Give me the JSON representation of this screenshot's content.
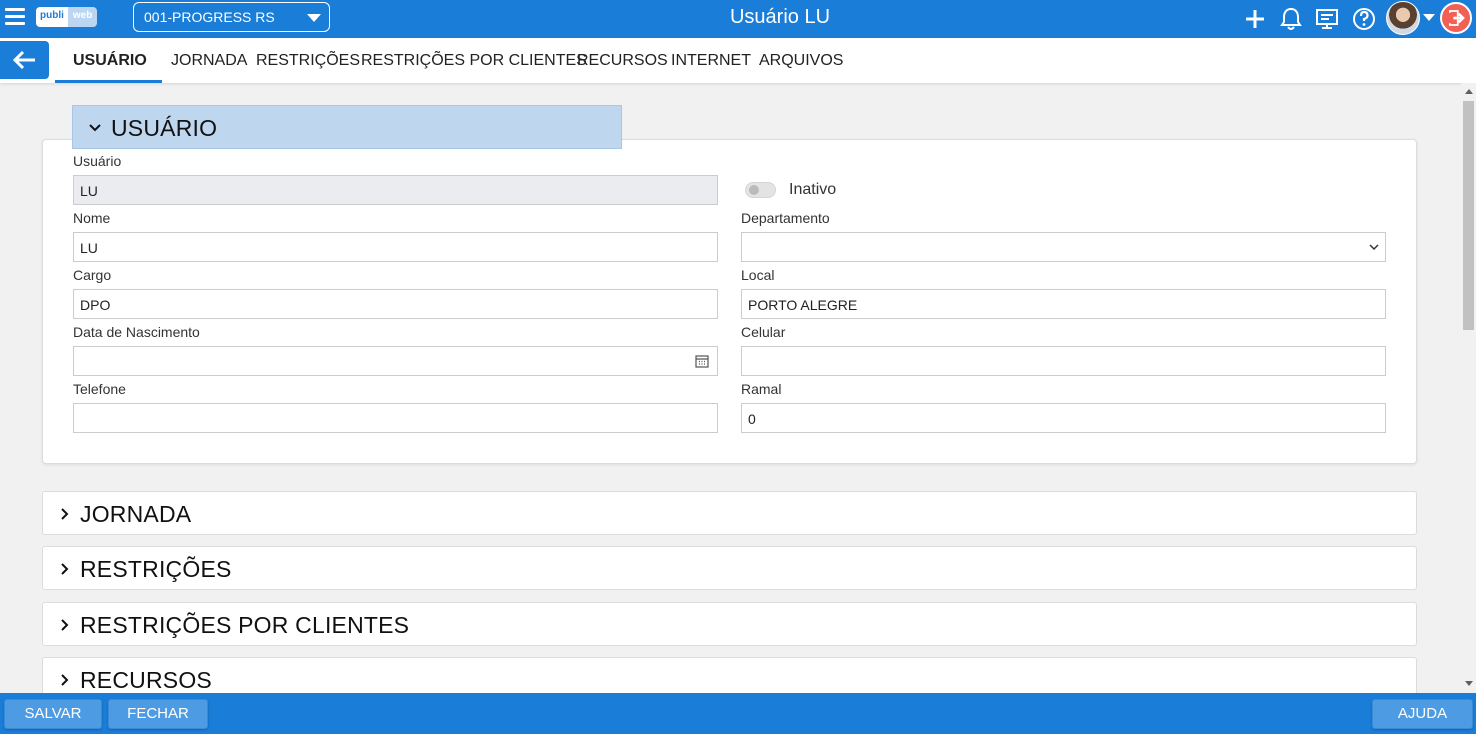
{
  "header": {
    "logo_part1": "publi",
    "logo_part2": "web",
    "company": "001-PROGRESS RS",
    "title": "Usuário LU",
    "icons": [
      "menu-icon",
      "plus-icon",
      "bell-icon",
      "monitor-icon",
      "help-icon",
      "avatar",
      "chevron-down-icon",
      "logout-icon"
    ]
  },
  "tabs": [
    {
      "label": "USUÁRIO",
      "active": true
    },
    {
      "label": "JORNADA"
    },
    {
      "label": "RESTRIÇÕES"
    },
    {
      "label": "RESTRIÇÕES POR CLIENTES"
    },
    {
      "label": "RECURSOS"
    },
    {
      "label": "INTERNET"
    },
    {
      "label": "ARQUIVOS"
    }
  ],
  "usuario_section": {
    "title": "USUÁRIO",
    "fields": {
      "usuario": {
        "label": "Usuário",
        "value": "LU"
      },
      "inativo": {
        "label": "Inativo",
        "checked": false
      },
      "nome": {
        "label": "Nome",
        "value": "LU"
      },
      "departamento": {
        "label": "Departamento",
        "value": ""
      },
      "cargo": {
        "label": "Cargo",
        "value": "DPO"
      },
      "local": {
        "label": "Local",
        "value": "PORTO ALEGRE"
      },
      "data_nascimento": {
        "label": "Data de Nascimento",
        "value": ""
      },
      "celular": {
        "label": "Celular",
        "value": ""
      },
      "telefone": {
        "label": "Telefone",
        "value": ""
      },
      "ramal": {
        "label": "Ramal",
        "value": "0"
      }
    }
  },
  "collapsed_sections": [
    "JORNADA",
    "RESTRIÇÕES",
    "RESTRIÇÕES POR CLIENTES",
    "RECURSOS"
  ],
  "footer": {
    "save": "SALVAR",
    "close": "FECHAR",
    "help": "AJUDA"
  },
  "colors": {
    "primary": "#1a7dd7",
    "section_header": "#bed6ee",
    "logout": "#f06055"
  }
}
